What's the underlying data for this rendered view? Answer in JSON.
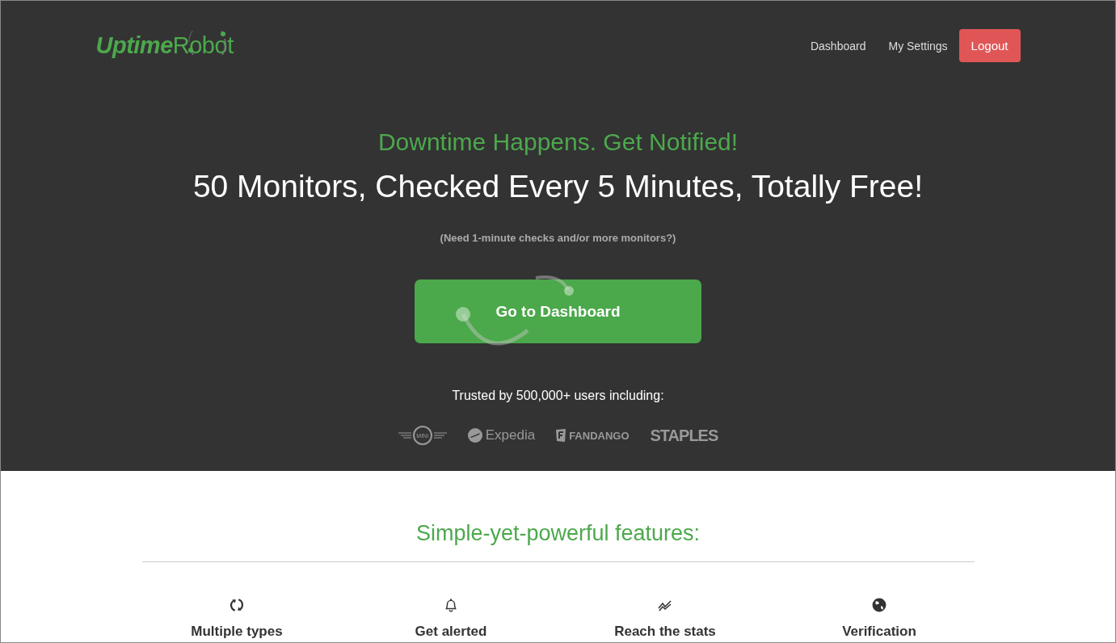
{
  "brand": {
    "logo": "**Uptime**Robot"
  },
  "nav": [
    {
      "label": "Dashboard",
      "kind": "link"
    },
    {
      "label": "My Settings",
      "kind": "link"
    },
    {
      "label": "Logout",
      "kind": "button"
    }
  ],
  "hero": {
    "tagline": "Downtime Happens. Get Notified!",
    "headline": "50 Monitors, Checked Every 5 Minutes, Totally Free!",
    "note": "(Need 1-minute checks and/or more monitors?)",
    "cta": "Go to Dashboard",
    "trusted": "Trusted by 500,000+ users including:",
    "logos": [
      {
        "kind": "wings",
        "text": "MINI"
      },
      {
        "kind": "globe",
        "text": "Expedia"
      },
      {
        "kind": "badge",
        "text": "FANDANGO"
      },
      {
        "kind": "plain",
        "text": "STAPLES"
      }
    ]
  },
  "features": {
    "title": "Simple-yet-powerful features:",
    "items": [
      {
        "kind": "types",
        "title": "Multiple types"
      },
      {
        "kind": "alerts",
        "title": "Get alerted"
      },
      {
        "kind": "stats",
        "title": "Reach the stats"
      },
      {
        "kind": "verify",
        "title": "Verification"
      }
    ]
  }
}
